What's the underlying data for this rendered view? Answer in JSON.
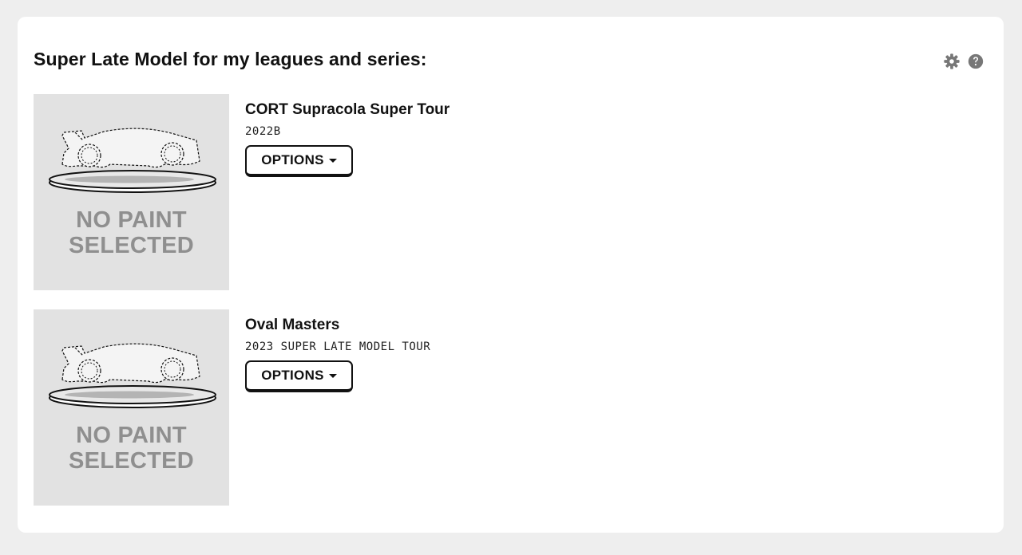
{
  "header": {
    "title": "Super Late Model for my leagues and series:",
    "icons": [
      "gear-icon",
      "help-icon"
    ]
  },
  "colors": {
    "background": "#eeeeee",
    "card": "#ffffff",
    "thumb_bg": "#e2e2e2",
    "placeholder_text": "#8f8f8f",
    "icon": "#777777"
  },
  "entries": [
    {
      "name": "CORT Supracola Super Tour",
      "season": "2022B",
      "options_label": "OPTIONS",
      "placeholder": {
        "line1": "NO PAINT",
        "line2": "SELECTED"
      }
    },
    {
      "name": "Oval Masters",
      "season": "2023 SUPER LATE MODEL TOUR",
      "options_label": "OPTIONS",
      "placeholder": {
        "line1": "NO PAINT",
        "line2": "SELECTED"
      }
    }
  ]
}
